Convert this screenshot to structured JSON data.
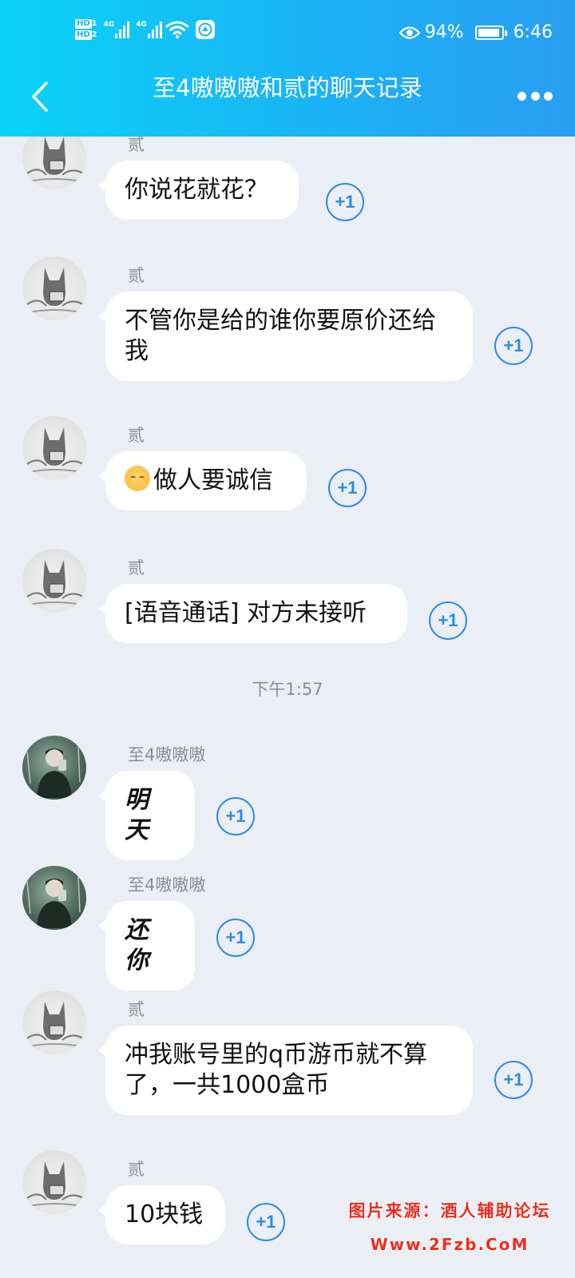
{
  "status_bar": {
    "hd1": "HD",
    "hd1_sub": "1",
    "hd2": "HD",
    "hd2_sub": "2",
    "net1": "4G",
    "net2": "4G",
    "battery_percent": "94%",
    "battery_level": 0.94,
    "time": "6:46",
    "icons": [
      "hd-icon",
      "signal-icon",
      "wifi-icon",
      "app-badge-icon",
      "eye-icon",
      "battery-icon"
    ]
  },
  "header": {
    "title": "至4嗷嗷嗷和贰的聊天记录",
    "back_icon": "chevron-left-icon",
    "more_icon": "more-dots-icon",
    "gradient": [
      "#0ad3f6",
      "#2a9ef2"
    ]
  },
  "messages": [
    {
      "sender": "贰",
      "text": "你说花就花？",
      "plus": "+1"
    },
    {
      "sender": "贰",
      "text": "不管你是给的谁你要原价还给我",
      "plus": "+1"
    },
    {
      "sender": "贰",
      "text": "做人要诚信",
      "emoji": "relieved-face-icon",
      "plus": "+1"
    },
    {
      "sender": "贰",
      "text": "[语音通话] 对方未接听",
      "plus": "+1"
    },
    {
      "sender": "至4嗷嗷嗷",
      "text": "明天",
      "plus": "+1"
    },
    {
      "sender": "至4嗷嗷嗷",
      "text": "还你",
      "plus": "+1"
    },
    {
      "sender": "贰",
      "text": "冲我账号里的q币游币就不算了，一共1000盒币",
      "plus": "+1"
    },
    {
      "sender": "贰",
      "text": "10块钱",
      "plus": "+1"
    }
  ],
  "time_divider": "下午1:57",
  "watermark": {
    "line1": "图片来源：酒人辅助论坛",
    "line2": "Www.2Fzb.CoM",
    "color": "#f02a1d"
  },
  "colors": {
    "chat_background": "#eceef5",
    "bubble": "#ffffff",
    "plus_one": "#2b8ce6",
    "meta_text": "#8a8d99"
  }
}
